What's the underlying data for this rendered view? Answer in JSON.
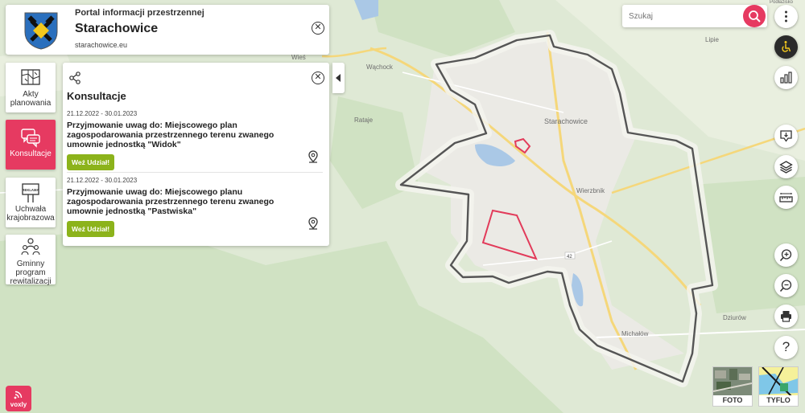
{
  "header": {
    "portal_label": "Portal informacji przestrzennej",
    "city": "Starachowice",
    "url": "starachowice.eu"
  },
  "nav": [
    {
      "id": "akty",
      "label": "Akty planowania",
      "icon": "map-plan-icon"
    },
    {
      "id": "konsultacje",
      "label": "Konsultacje",
      "icon": "chat-bubbles-icon",
      "active": true
    },
    {
      "id": "uchwala",
      "label": "Uchwała krajobrazowa",
      "icon": "billboard-icon",
      "sign_text": "REKLAMA"
    },
    {
      "id": "rewitalizacja",
      "label": "Gminny program rewitalizacji",
      "icon": "people-group-icon"
    }
  ],
  "panel": {
    "title": "Konsultacje",
    "consultations": [
      {
        "date": "21.12.2022 - 30.01.2023",
        "text": "Przyjmowanie uwag do: Miejscowego plan zagospodarowania przestrzennego terenu zwanego umownie jednostką \"Widok\"",
        "button": "Weź Udział!"
      },
      {
        "date": "21.12.2022 - 30.01.2023",
        "text": "Przyjmowanie uwag do: Miejscowego planu zagospodarowania przestrzennego terenu zwanego umownie jednostką \"Pastwiska\"",
        "button": "Weź Udział!"
      }
    ]
  },
  "search": {
    "placeholder": "Szukaj"
  },
  "map_labels": {
    "wachock": "Wąchock",
    "starachowice": "Starachowice",
    "wierzbnik": "Wierzbnik",
    "michalow": "Michałów",
    "dziurow": "Dziurów",
    "rataje": "Rataje",
    "lipie": "Lipie",
    "wies": "Wieś",
    "road_42": "42",
    "podlazisko": "Podłazisko"
  },
  "thumbs": [
    {
      "label": "FOTO"
    },
    {
      "label": "TYFLO"
    }
  ],
  "voxly": {
    "label": "voxly"
  },
  "colors": {
    "accent": "#e63a61",
    "button_green": "#8cb31b",
    "boundary": "#555555",
    "plan_outline": "#e23b5a",
    "forest": "#d2e4c6",
    "urban": "#ecebe6"
  }
}
